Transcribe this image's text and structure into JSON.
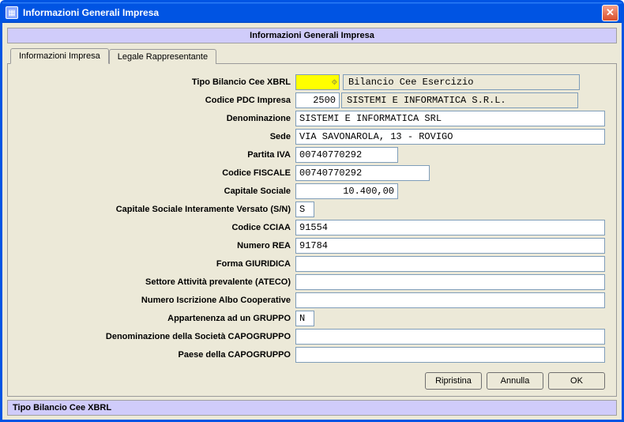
{
  "window": {
    "title": "Informazioni Generali Impresa"
  },
  "header": {
    "title": "Informazioni Generali Impresa"
  },
  "tabs": {
    "items": [
      {
        "label": "Informazioni Impresa",
        "active": true
      },
      {
        "label": "Legale Rappresentante",
        "active": false
      }
    ]
  },
  "form": {
    "tipo_bilancio_label": "Tipo Bilancio Cee XBRL",
    "tipo_bilancio_desc": "Bilancio Cee Esercizio",
    "codice_pdc_label": "Codice PDC Impresa",
    "codice_pdc_value": "2500",
    "codice_pdc_desc": "SISTEMI E INFORMATICA S.R.L.",
    "denominazione_label": "Denominazione",
    "denominazione_value": "SISTEMI E INFORMATICA SRL",
    "sede_label": "Sede",
    "sede_value": "VIA SAVONAROLA, 13 - ROVIGO",
    "partita_iva_label": "Partita IVA",
    "partita_iva_value": "00740770292",
    "codice_fiscale_label": "Codice FISCALE",
    "codice_fiscale_value": "00740770292",
    "capitale_sociale_label": "Capitale Sociale",
    "capitale_sociale_value": "10.400,00",
    "capitale_versato_label": "Capitale Sociale Interamente Versato (S/N)",
    "capitale_versato_value": "S",
    "codice_cciaa_label": "Codice CCIAA",
    "codice_cciaa_value": "91554",
    "numero_rea_label": "Numero REA",
    "numero_rea_value": "91784",
    "forma_giuridica_label": "Forma GIURIDICA",
    "forma_giuridica_value": "",
    "settore_ateco_label": "Settore Attività prevalente (ATECO)",
    "settore_ateco_value": "",
    "iscrizione_albo_label": "Numero Iscrizione Albo Cooperative",
    "iscrizione_albo_value": "",
    "appartenenza_gruppo_label": "Appartenenza ad un GRUPPO",
    "appartenenza_gruppo_value": "N",
    "denominazione_capogruppo_label": "Denominazione della Società CAPOGRUPPO",
    "denominazione_capogruppo_value": "",
    "paese_capogruppo_label": "Paese della CAPOGRUPPO",
    "paese_capogruppo_value": ""
  },
  "buttons": {
    "ripristina": "Ripristina",
    "annulla": "Annulla",
    "ok": "OK"
  },
  "status": {
    "text": "Tipo Bilancio Cee XBRL"
  }
}
